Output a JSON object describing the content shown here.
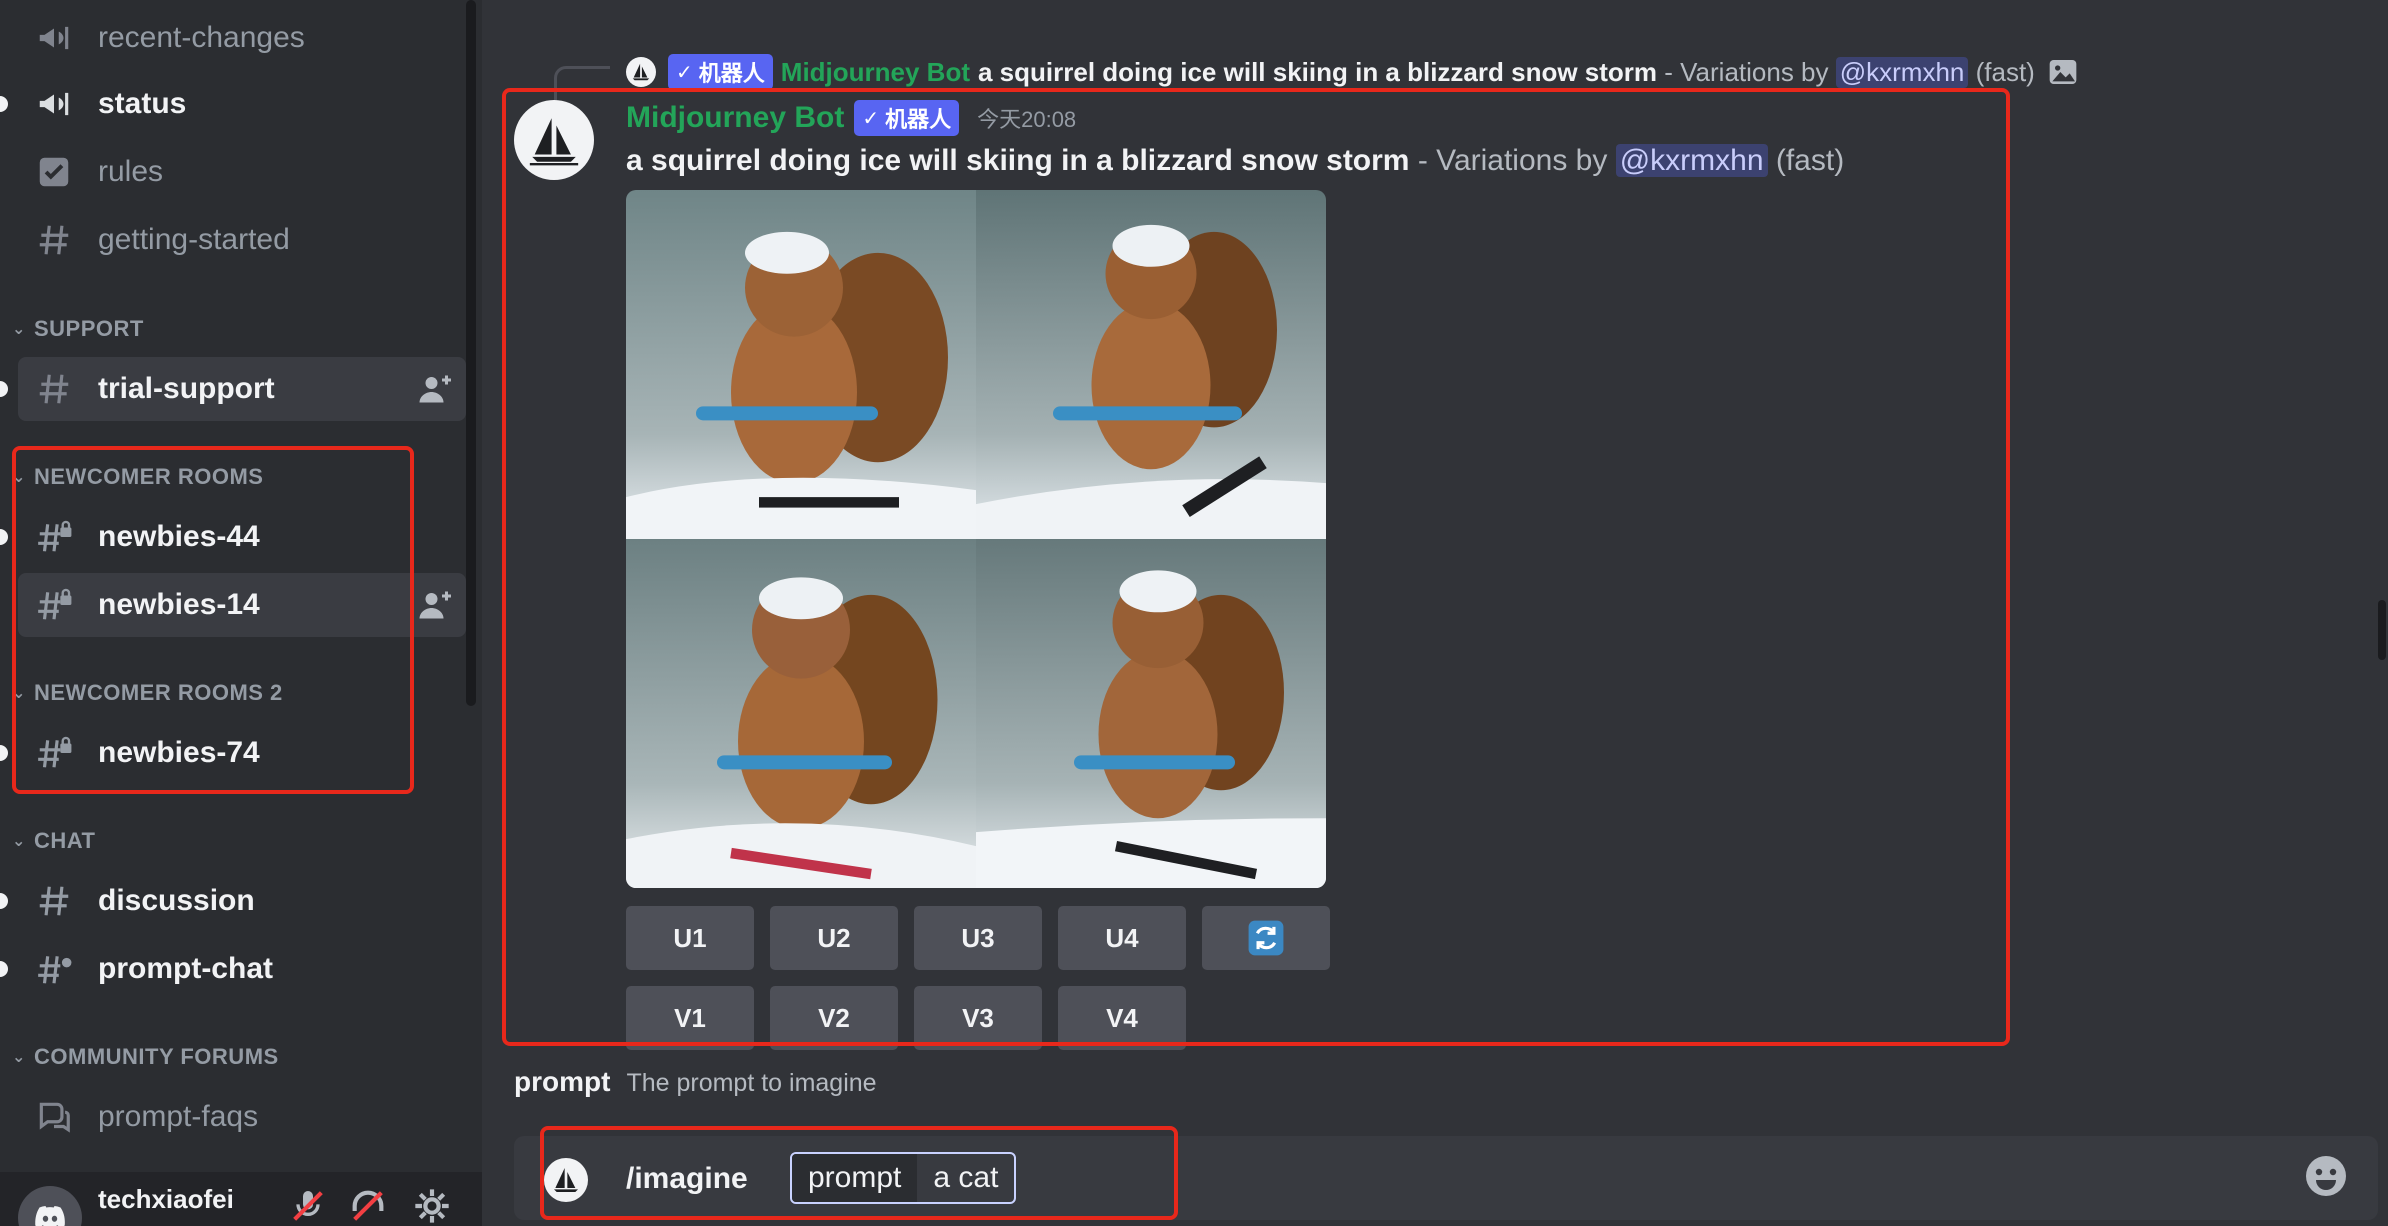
{
  "sidebar": {
    "channels_top": [
      {
        "name": "recent-changes",
        "icon": "announcement-icon",
        "bright": false
      },
      {
        "name": "status",
        "icon": "announcement-icon",
        "bright": true
      },
      {
        "name": "rules",
        "icon": "rules-checkbox-icon",
        "bright": false
      },
      {
        "name": "getting-started",
        "icon": "hash-icon",
        "bright": false
      }
    ],
    "categories": {
      "support": "SUPPORT",
      "newcomer": "NEWCOMER ROOMS",
      "newcomer2": "NEWCOMER ROOMS 2",
      "chat": "CHAT",
      "forums": "COMMUNITY FORUMS"
    },
    "channels": {
      "trial_support": "trial-support",
      "newbies_44": "newbies-44",
      "newbies_14": "newbies-14",
      "newbies_74": "newbies-74",
      "discussion": "discussion",
      "prompt_chat": "prompt-chat",
      "prompt_faqs": "prompt-faqs"
    },
    "user": {
      "name": "techxiaofei"
    }
  },
  "reply": {
    "bot_tag": "机器人",
    "bot_name": "Midjourney Bot",
    "prompt": "a squirrel doing ice will skiing in a blizzard snow storm",
    "suffix": " - Variations by ",
    "mention": "@kxrmxhn",
    "speed": " (fast)"
  },
  "message": {
    "bot_name": "Midjourney Bot",
    "bot_tag": "机器人",
    "timestamp": "今天20:08",
    "prompt": "a squirrel doing ice will skiing in a blizzard snow storm",
    "suffix": " - Variations by ",
    "mention": "@kxrmxhn",
    "speed": " (fast)",
    "upscale_buttons": [
      "U1",
      "U2",
      "U3",
      "U4"
    ],
    "variation_buttons": [
      "V1",
      "V2",
      "V3",
      "V4"
    ],
    "reroll_icon": "refresh-icon"
  },
  "command_option": {
    "name": "prompt",
    "description": "The prompt to imagine"
  },
  "composer": {
    "command": "/imagine",
    "param_name": "prompt",
    "param_value": "a cat"
  },
  "colors": {
    "accent": "#5865f2",
    "bot_green": "#23a559",
    "highlight_box": "#e8281b",
    "background": "#313338",
    "sidebar": "#2b2d31"
  }
}
